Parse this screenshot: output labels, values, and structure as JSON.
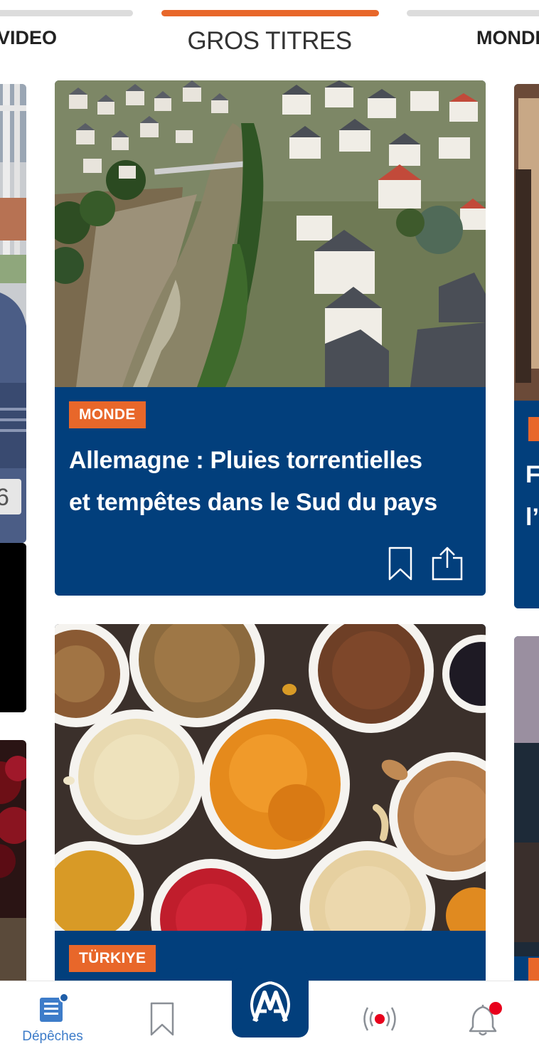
{
  "tabs": {
    "left": "VIDEO",
    "center": "GROS TITRES",
    "right": "MONDE"
  },
  "articles": [
    {
      "category": "MONDE",
      "headline_line1": "Allemagne : Pluies torrentielles",
      "headline_line2": "et tempêtes dans le Sud du pays",
      "image": "aerial-flooded-village-river"
    },
    {
      "category": "TÜRKIYE",
      "image": "bowls-of-dried-fruits-and-nuts"
    }
  ],
  "icons": {
    "bookmark": "bookmark-icon",
    "share": "share-icon"
  },
  "bottom_nav": {
    "depeches_label": "Dépêches",
    "home_logo": "AA"
  },
  "colors": {
    "accent": "#e8672a",
    "card_blue": "#023f7c",
    "nav_active": "#3d7cc9",
    "badge_red": "#e8001c"
  }
}
